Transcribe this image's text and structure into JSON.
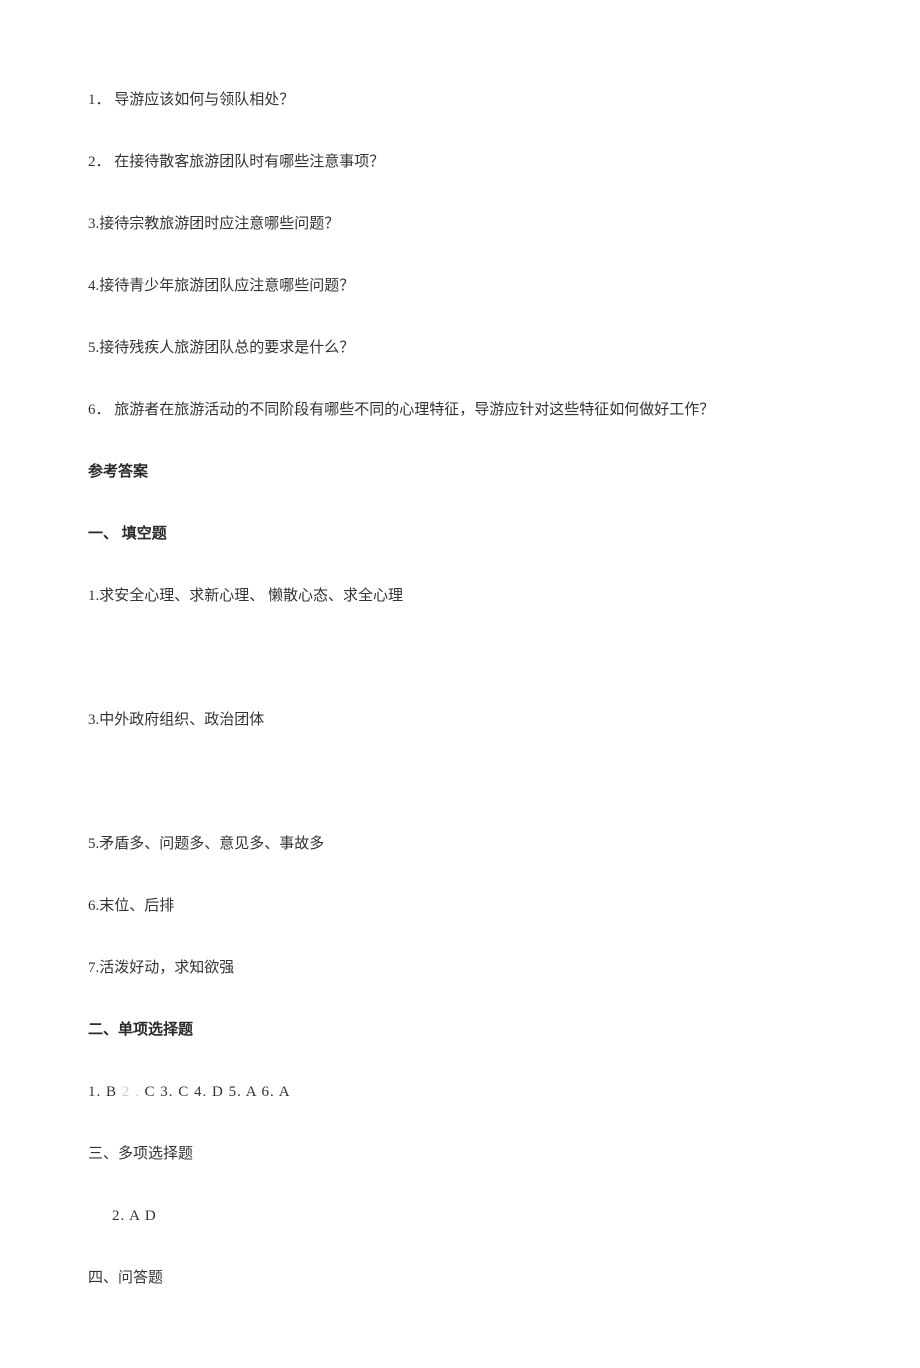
{
  "questions": {
    "q1": "1． 导游应该如何与领队相处？",
    "q2": "2． 在接待散客旅游团队时有哪些注意事项？",
    "q3": "3.接待宗教旅游团时应注意哪些问题？",
    "q4": "4.接待青少年旅游团队应注意哪些问题？",
    "q5": "5.接待残疾人旅游团队总的要求是什么？",
    "q6": "6． 旅游者在旅游活动的不同阶段有哪些不同的心理特征，导游应针对这些特征如何做好工作？"
  },
  "answers_heading": "参考答案",
  "section1": {
    "heading": "一、        填空题",
    "a1": "1.求安全心理、求新心理、  懒散心态、求全心理",
    "a3": "3.中外政府组织、政治团体",
    "a5": "5.矛盾多、问题多、意见多、事故多",
    "a6": "6.末位、后排",
    "a7": "7.活泼好动，求知欲强"
  },
  "section2": {
    "heading": "二、单项选择题",
    "answers_prefix": "1.  B   ",
    "answers_faint": "2 .",
    "answers_suffix": "  C  3.  C     4.    D     5.  A     6.  A"
  },
  "section3": {
    "heading": "三、多项选择题",
    "a2": "2.  A D"
  },
  "section4": {
    "heading": "四、问答题"
  }
}
